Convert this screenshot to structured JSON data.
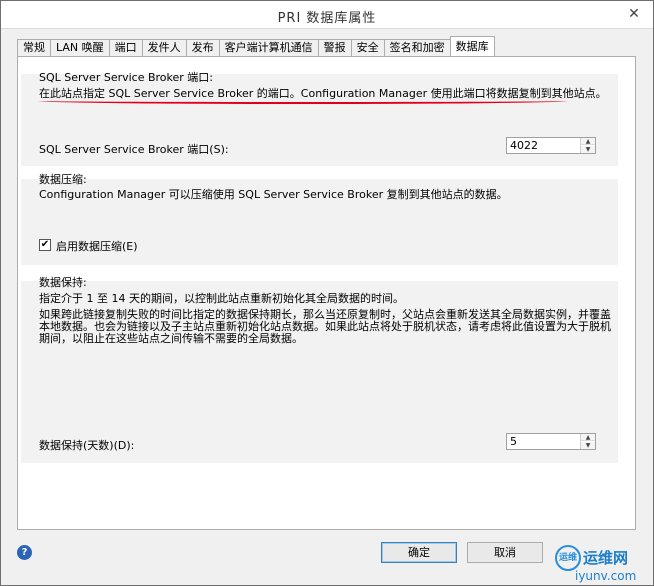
{
  "window": {
    "title": "PRI 数据库属性",
    "close_glyph": "✕"
  },
  "tabs": [
    {
      "label": "常规",
      "active": false
    },
    {
      "label": "LAN 唤醒",
      "active": false
    },
    {
      "label": "端口",
      "active": false
    },
    {
      "label": "发件人",
      "active": false
    },
    {
      "label": "发布",
      "active": false
    },
    {
      "label": "客户端计算机通信",
      "active": false
    },
    {
      "label": "警报",
      "active": false
    },
    {
      "label": "安全",
      "active": false
    },
    {
      "label": "签名和加密",
      "active": false
    },
    {
      "label": "数据库",
      "active": true
    }
  ],
  "broker": {
    "heading": "SQL Server Service Broker 端口:",
    "description": "在此站点指定 SQL Server Service Broker 的端口。Configuration Manager 使用此端口将数据复制到其他站点。",
    "port_label": "SQL Server Service Broker 端口(S):",
    "port_value": "4022"
  },
  "compression": {
    "heading": "数据压缩:",
    "description": "Configuration Manager 可以压缩使用 SQL Server Service Broker 复制到其他站点的数据。",
    "checkbox_label": "启用数据压缩(E)",
    "checked": true,
    "check_glyph": "✔"
  },
  "retention": {
    "heading": "数据保持:",
    "line1": "指定介于 1 至 14 天的期间，以控制此站点重新初始化其全局数据的时间。",
    "paragraph": "如果跨此链接复制失败的时间比指定的数据保持期长，那么当还原复制时，父站点会重新发送其全局数据实例，并覆盖本地数据。也会为链接以及子主站点重新初始化站点数据。如果此站点将处于脱机状态，请考虑将此值设置为大于脱机期间，以阻止在这些站点之间传输不需要的全局数据。",
    "days_label": "数据保持(天数)(D):",
    "days_value": "5"
  },
  "buttons": {
    "ok": "确定",
    "cancel": "取消"
  },
  "help_glyph": "?",
  "spin": {
    "up": "▲",
    "down": "▼"
  },
  "watermark": {
    "icon_text": "运维",
    "main": "运维网",
    "sub": "iyunv.com"
  },
  "colors": {
    "annotation_red": "#e0001b",
    "accent_blue": "#2a63b8"
  }
}
